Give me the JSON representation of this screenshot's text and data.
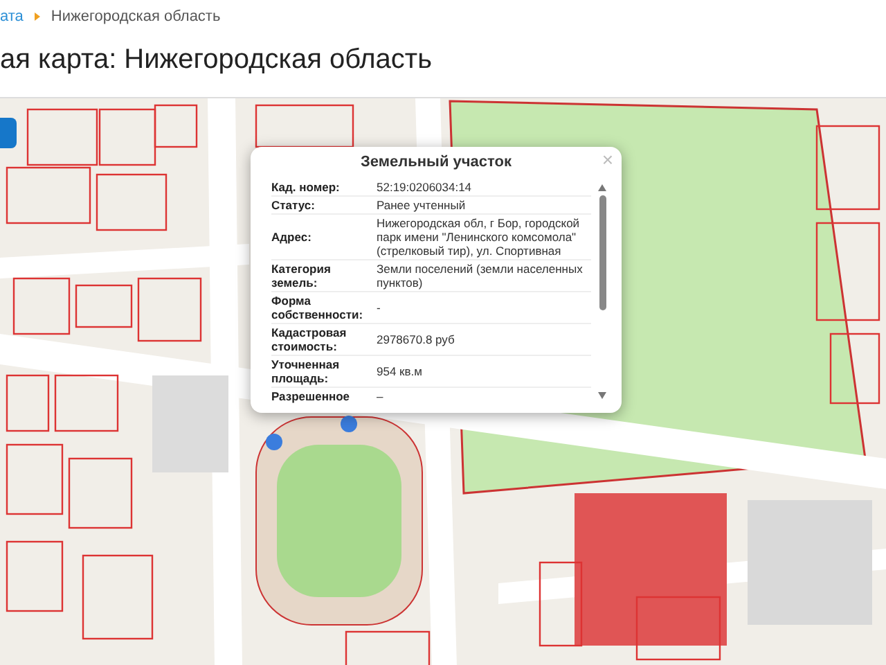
{
  "breadcrumbs": [
    {
      "label": "ата",
      "kind": "link"
    },
    {
      "label": "Нижегородская область",
      "kind": "current"
    }
  ],
  "title": "ая карта: Нижегородская область",
  "popup": {
    "title": "Земельный участок",
    "close": "×",
    "rows": [
      {
        "label": "Кад. номер:",
        "value": "52:19:0206034:14"
      },
      {
        "label": "Статус:",
        "value": "Ранее учтенный"
      },
      {
        "label": "Адрес:",
        "value": "Нижегородская обл, г Бор, городской парк имени \"Ленинского комсомола\" (стрелковый тир), ул. Спортивная"
      },
      {
        "label": "Категория земель:",
        "value": "Земли поселений (земли населенных пунктов)"
      },
      {
        "label": "Форма собственности:",
        "value": "-"
      },
      {
        "label": "Кадастровая стоимость:",
        "value": "2978670.8 руб"
      },
      {
        "label": "Уточненная площадь:",
        "value": "954 кв.м"
      },
      {
        "label": "Разрешенное",
        "value": "–"
      }
    ]
  }
}
